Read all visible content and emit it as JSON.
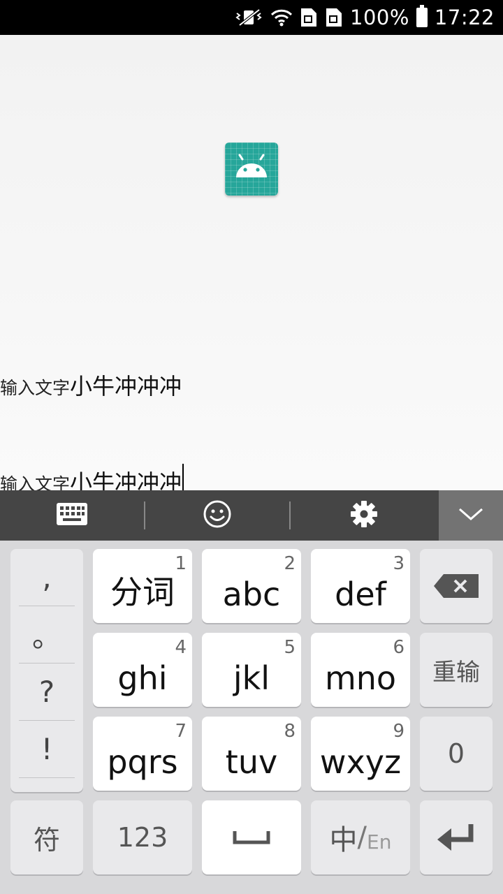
{
  "status_bar": {
    "battery_percent": "100%",
    "time": "17:22",
    "icons": [
      "vibrate-mute-icon",
      "wifi-icon",
      "sim1-icon",
      "sim2-icon",
      "battery-icon"
    ]
  },
  "app": {
    "logo_icon": "android-app-icon",
    "logo_color": "#26a69a",
    "row1": {
      "label": "输入文字",
      "value": "小牛冲冲冲"
    },
    "row2": {
      "label": "输入文字",
      "value": "小牛冲冲冲"
    }
  },
  "keyboard_toolbar": {
    "buttons": [
      "keyboard-icon",
      "emoji-icon",
      "settings-gear-icon",
      "collapse-chevron-icon"
    ]
  },
  "keyboard": {
    "punctuation": [
      ",",
      "。",
      "?",
      "!"
    ],
    "keys": [
      {
        "num": "1",
        "label": "分词"
      },
      {
        "num": "2",
        "label": "abc"
      },
      {
        "num": "3",
        "label": "def"
      },
      {
        "num": "4",
        "label": "ghi"
      },
      {
        "num": "5",
        "label": "jkl"
      },
      {
        "num": "6",
        "label": "mno"
      },
      {
        "num": "7",
        "label": "pqrs"
      },
      {
        "num": "8",
        "label": "tuv"
      },
      {
        "num": "9",
        "label": "wxyz"
      }
    ],
    "reinput": "重输",
    "zero": "0",
    "symbols": "符",
    "numeric": "123",
    "lang_zh": "中",
    "lang_sep": "/",
    "lang_en": "En"
  }
}
